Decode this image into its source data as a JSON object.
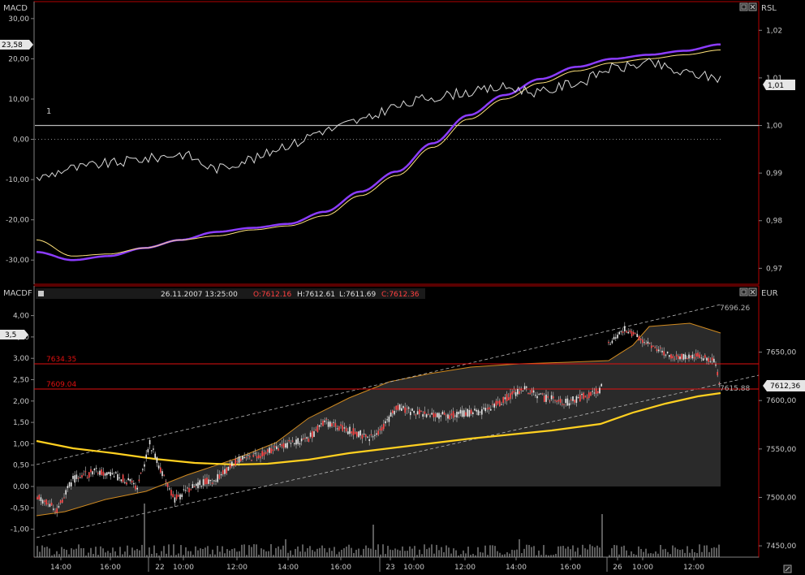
{
  "colors": {
    "background": "#000000",
    "axis": "#c8c8c8",
    "frame_red": "#b40000",
    "macd_line": "#8c3cff",
    "signal_line": "#ffe27a",
    "price_line": "#d8d8d8",
    "ma_slow": "#ffd020",
    "envelope": "#d08a20",
    "band_fill": "#2a2a2a",
    "volume": "#9a9a9a",
    "hline_red": "#e01010",
    "ohlc_red": "#ff4040"
  },
  "top_panel": {
    "left_title": "MACD",
    "right_title": "RSL",
    "level_label": "1",
    "value_badge_left": "23,58",
    "value_badge_right": "1,01",
    "yaxis_left_ticks": [
      "30,00",
      "20,00",
      "10,00",
      "0,00",
      "-10,00",
      "-20,00",
      "-30,00"
    ],
    "yaxis_right_ticks": [
      "1,02",
      "1,01",
      "1,00",
      "0,99",
      "0,98",
      "0,97"
    ],
    "icons": [
      "minimize-icon",
      "close-icon"
    ]
  },
  "bottom_panel": {
    "left_title": "MACDF",
    "right_title": "EUR",
    "info_date": "26.11.2007 13:25:00",
    "info_open": "O:7612.16",
    "info_high": "H:7612.61",
    "info_low": "L:7611.69",
    "info_close": "C:7612.36",
    "value_badge_left": "3,5",
    "value_badge_right": "7612,36",
    "hline_1": "7634.35",
    "hline_2": "7609.04",
    "channel_top_label": "7696.26",
    "channel_bottom_label": "7615.88",
    "yaxis_left_ticks": [
      "4,00",
      "3,50",
      "3,00",
      "2,50",
      "2,00",
      "1,50",
      "1,00",
      "0,50",
      "0,00",
      "-0,50",
      "-1,00"
    ],
    "yaxis_right_ticks": [
      "7650,00",
      "7600,00",
      "7550,00",
      "7500,00",
      "7450,00"
    ],
    "icons": [
      "minimize-icon",
      "close-icon"
    ]
  },
  "xaxis_labels": [
    "14:00",
    "16:00",
    "22",
    "10:00",
    "12:00",
    "14:00",
    "16:00",
    "23",
    "10:00",
    "12:00",
    "14:00",
    "16:00",
    "26",
    "10:00",
    "12:00"
  ],
  "chart_data": [
    {
      "type": "line",
      "title": "MACD",
      "yaxis_left_range": [
        -35,
        33
      ],
      "yaxis_right_range": [
        0.9675,
        1.025
      ],
      "series": [
        {
          "name": "MACD",
          "axis": "left",
          "color": "#8c3cff",
          "values": [
            -28,
            -30,
            -29,
            -27,
            -25,
            -23,
            -22,
            -21,
            -18,
            -13,
            -8,
            -1,
            6,
            11,
            15,
            18,
            20,
            21,
            22,
            23.58
          ]
        },
        {
          "name": "Signal",
          "axis": "left",
          "color": "#ffe27a",
          "values": [
            -25,
            -29,
            -28.5,
            -27,
            -25,
            -24,
            -22.5,
            -21.5,
            -19,
            -14,
            -9,
            -2,
            5,
            10,
            14,
            17,
            19,
            20,
            21,
            22.2
          ]
        },
        {
          "name": "RSL",
          "axis": "right",
          "color": "#d8d8d8",
          "values": [
            0.989,
            0.991,
            0.992,
            0.993,
            0.994,
            0.991,
            0.993,
            0.996,
            0.999,
            1.001,
            1.004,
            1.006,
            1.007,
            1.008,
            1.007,
            1.009,
            1.012,
            1.013,
            1.011,
            1.01
          ]
        }
      ],
      "level_value": 1.0
    },
    {
      "type": "line",
      "title": "MACDF",
      "yaxis_right_range": [
        7440,
        7705
      ],
      "x": [
        "14:00",
        "16:00",
        "22 10:00",
        "12:00",
        "14:00",
        "16:00",
        "23 10:00",
        "12:00",
        "14:00",
        "16:00",
        "26 10:00",
        "12:00"
      ],
      "series": [
        {
          "name": "EUR",
          "color": "#d8d8d8",
          "values": [
            7498,
            7510,
            7520,
            7512,
            7528,
            7558,
            7580,
            7592,
            7598,
            7603,
            7608,
            7612,
            7614,
            7632,
            7658,
            7665,
            7650,
            7640,
            7612.36
          ]
        },
        {
          "name": "MA",
          "color": "#ffd020",
          "values": [
            7560,
            7553,
            7545,
            7540,
            7537,
            7541,
            7550,
            7560,
            7565,
            7568,
            7574,
            7583,
            7588,
            7605,
            7610,
            7612
          ]
        }
      ],
      "horizontal_lines": [
        7634.35,
        7609.04
      ],
      "channel": {
        "top": 7696.26,
        "bottom": 7615.88
      },
      "volume": true
    }
  ]
}
